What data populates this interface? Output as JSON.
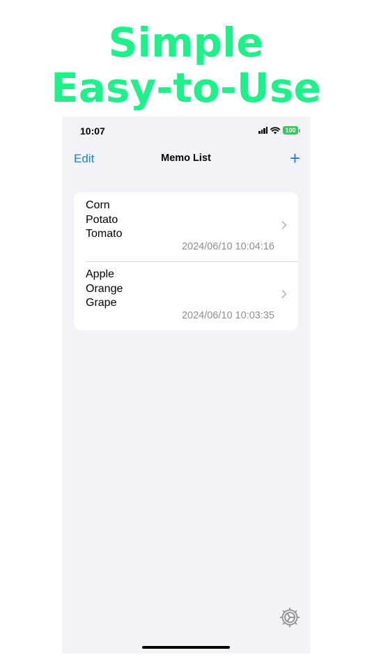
{
  "headline": {
    "line1": "Simple",
    "line2": "Easy-to-Use",
    "color": "#1EF08A"
  },
  "status_bar": {
    "time": "10:07",
    "battery_percent": "100",
    "icons": [
      "signal-icon",
      "wifi-icon",
      "battery-icon"
    ]
  },
  "nav": {
    "edit_label": "Edit",
    "title": "Memo List",
    "add_label": "+",
    "accent_color": "#1E7BD6"
  },
  "memos": [
    {
      "lines": [
        "Corn",
        "Potato",
        "Tomato"
      ],
      "date": "2024/06/10 10:04:16"
    },
    {
      "lines": [
        "Apple",
        "Orange",
        "Grape"
      ],
      "date": "2024/06/10 10:03:35"
    }
  ],
  "footer": {
    "settings_icon": "gear-icon"
  }
}
